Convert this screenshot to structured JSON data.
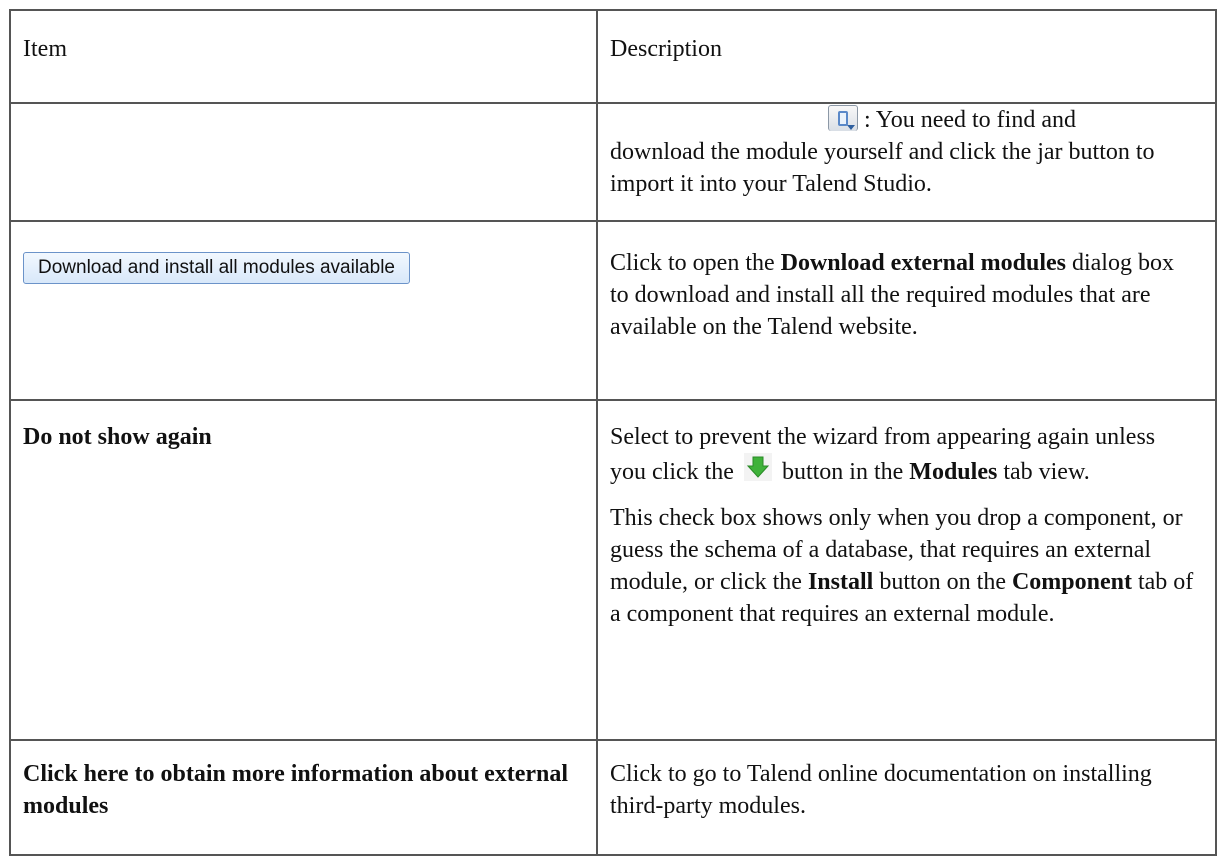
{
  "table": {
    "header": {
      "item": "Item",
      "description": "Description"
    },
    "rows": {
      "jar": {
        "icon": "jar-button-icon",
        "text_line1": ": You need to find and",
        "text_rest": "download the module yourself and click the jar button to import it into your Talend Studio."
      },
      "download_all": {
        "button_label": "Download and install all modules available",
        "desc_before": "Click to open the ",
        "desc_bold": "Download external modules",
        "desc_after": " dialog box to download and install all the required modules that are available on the Talend website."
      },
      "do_not_show": {
        "item_label": "Do not show again",
        "p1_before": "Select to prevent the wizard from appearing again unless you click the ",
        "p1_icon": "green-down-arrow-icon",
        "p1_mid": " button in the ",
        "p1_bold": "Modules",
        "p1_after": " tab view.",
        "p2_part1": "This check box shows only when you drop a component, or guess the schema of a database, that requires an external module, or click the ",
        "p2_bold1": "Install",
        "p2_part2": " button on the ",
        "p2_bold2": "Component",
        "p2_part3": " tab of a component that requires an external module."
      },
      "more_info": {
        "item_label": "Click here to obtain more information about external modules",
        "description": "Click to go to Talend online documentation on installing third-party modules."
      }
    }
  }
}
